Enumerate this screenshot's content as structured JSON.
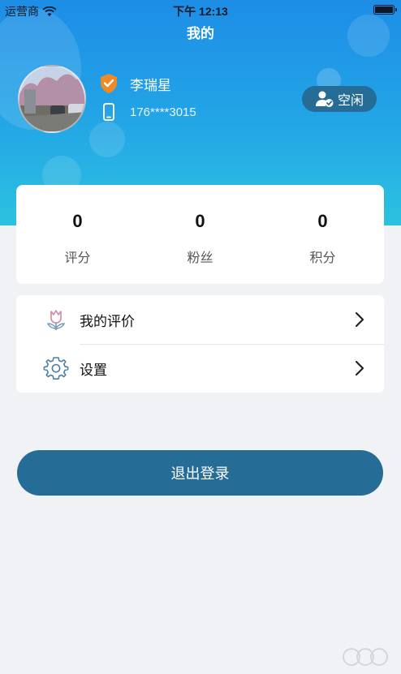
{
  "status_bar": {
    "carrier": "运营商",
    "time": "下午 12:13"
  },
  "header": {
    "title": "我的"
  },
  "profile": {
    "name": "李瑞星",
    "phone": "176****3015",
    "status_label": "空闲"
  },
  "stats": [
    {
      "value": "0",
      "label": "评分"
    },
    {
      "value": "0",
      "label": "粉丝"
    },
    {
      "value": "0",
      "label": "积分"
    }
  ],
  "menu": [
    {
      "label": "我的评价",
      "icon": "flower-icon"
    },
    {
      "label": "设置",
      "icon": "gear-icon"
    }
  ],
  "logout": {
    "label": "退出登录"
  },
  "colors": {
    "header_top": "#1d8de6",
    "header_bottom": "#2cc2df",
    "accent": "#256c96",
    "background": "#f1f2f6"
  }
}
